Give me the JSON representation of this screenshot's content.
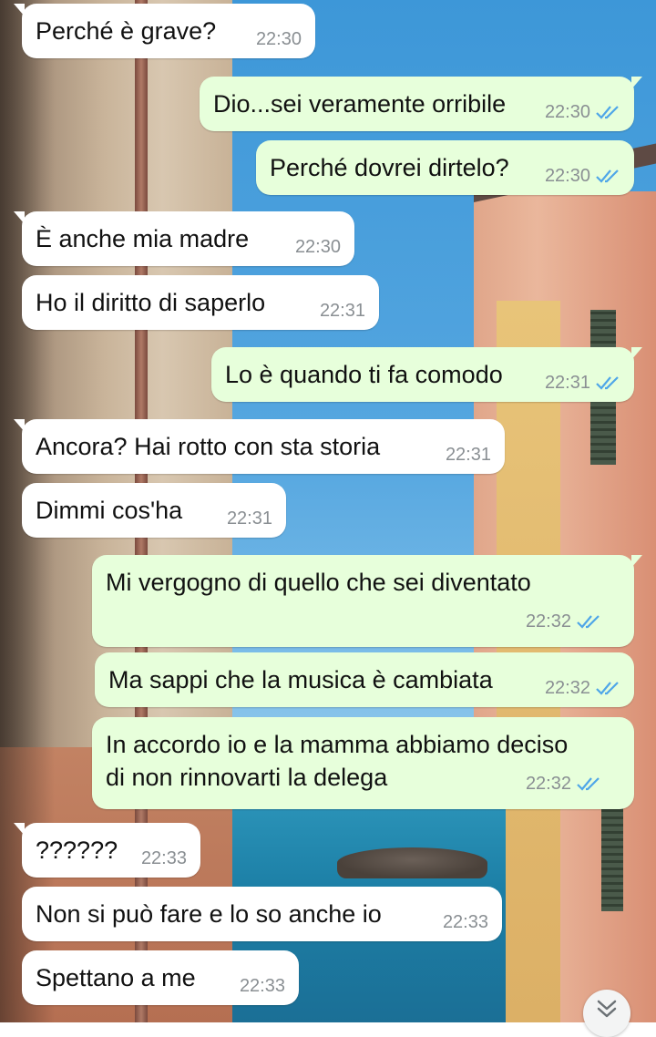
{
  "colors": {
    "incoming_bubble": "#ffffff",
    "outgoing_bubble": "#e7ffdb",
    "timestamp": "#8a8f93",
    "read_ticks": "#4fa6e8"
  },
  "messages": [
    {
      "direction": "in",
      "text": "Perché è grave?",
      "time": "22:30"
    },
    {
      "direction": "out",
      "text": "Dio...sei veramente orribile",
      "time": "22:30",
      "status": "read"
    },
    {
      "direction": "out",
      "text": "Perché dovrei dirtelo?",
      "time": "22:30",
      "status": "read"
    },
    {
      "direction": "in",
      "text": "È anche mia madre",
      "time": "22:30"
    },
    {
      "direction": "in",
      "text": "Ho il diritto di saperlo",
      "time": "22:31"
    },
    {
      "direction": "out",
      "text": "Lo è quando ti fa comodo",
      "time": "22:31",
      "status": "read"
    },
    {
      "direction": "in",
      "text": "Ancora? Hai rotto con sta storia",
      "time": "22:31"
    },
    {
      "direction": "in",
      "text": "Dimmi cos'ha",
      "time": "22:31"
    },
    {
      "direction": "out",
      "text": "Mi vergogno di quello che sei diventato",
      "time": "22:32",
      "status": "read"
    },
    {
      "direction": "out",
      "text": "Ma sappi che la musica è cambiata",
      "time": "22:32",
      "status": "read"
    },
    {
      "direction": "out",
      "text": "In accordo io e la mamma abbiamo deciso\ndi non rinnovarti la delega",
      "time": "22:32",
      "status": "read"
    },
    {
      "direction": "in",
      "text": "??????",
      "time": "22:33"
    },
    {
      "direction": "in",
      "text": "Non si può fare e lo so anche io",
      "time": "22:33"
    },
    {
      "direction": "in",
      "text": "Spettano a me",
      "time": "22:33"
    }
  ],
  "scroll_button_icon": "double-chevron-down-icon"
}
